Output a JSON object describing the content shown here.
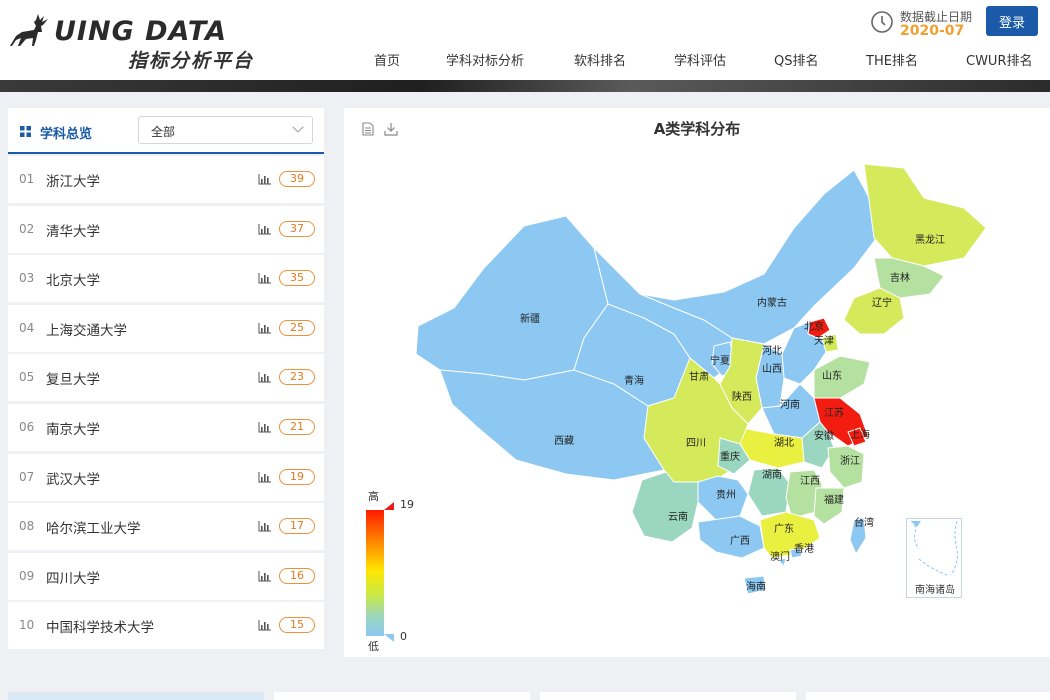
{
  "header": {
    "brand": "UING DATA",
    "subtitle": "指标分析平台",
    "date_label": "数据截止日期",
    "date_value": "2020-07",
    "login_label": "登录",
    "nav": [
      "首页",
      "学科对标分析",
      "软科排名",
      "学科评估",
      "QS排名",
      "THE排名",
      "CWUR排名"
    ]
  },
  "left_panel": {
    "title": "学科总览",
    "select_value": "全部",
    "items": [
      {
        "no": "01",
        "name": "浙江大学",
        "count": "39"
      },
      {
        "no": "02",
        "name": "清华大学",
        "count": "37"
      },
      {
        "no": "03",
        "name": "北京大学",
        "count": "35"
      },
      {
        "no": "04",
        "name": "上海交通大学",
        "count": "25"
      },
      {
        "no": "05",
        "name": "复旦大学",
        "count": "23"
      },
      {
        "no": "06",
        "name": "南京大学",
        "count": "21"
      },
      {
        "no": "07",
        "name": "武汉大学",
        "count": "19"
      },
      {
        "no": "08",
        "name": "哈尔滨工业大学",
        "count": "17"
      },
      {
        "no": "09",
        "name": "四川大学",
        "count": "16"
      },
      {
        "no": "10",
        "name": "中国科学技术大学",
        "count": "15"
      }
    ]
  },
  "map": {
    "title": "A类学科分布",
    "legend_high": "高",
    "legend_low": "低",
    "legend_max": "19",
    "legend_min": "0",
    "inset_label": "南海诸岛",
    "colors": {
      "blue": "#8cc8f2",
      "teal": "#9ad6c0",
      "green": "#b4e0a0",
      "lime": "#d4ea5a",
      "yellow": "#eaf040",
      "red": "#f21c10"
    },
    "regions": [
      {
        "name": "新疆",
        "level": "blue"
      },
      {
        "name": "西藏",
        "level": "blue"
      },
      {
        "name": "青海",
        "level": "blue"
      },
      {
        "name": "甘肃",
        "level": "blue"
      },
      {
        "name": "内蒙古",
        "level": "blue"
      },
      {
        "name": "黑龙江",
        "level": "lime"
      },
      {
        "name": "吉林",
        "level": "green"
      },
      {
        "name": "辽宁",
        "level": "lime"
      },
      {
        "name": "北京",
        "level": "red"
      },
      {
        "name": "天津",
        "level": "lime"
      },
      {
        "name": "河北",
        "level": "blue"
      },
      {
        "name": "山西",
        "level": "blue"
      },
      {
        "name": "宁夏",
        "level": "blue"
      },
      {
        "name": "陕西",
        "level": "lime"
      },
      {
        "name": "山东",
        "level": "green"
      },
      {
        "name": "河南",
        "level": "blue"
      },
      {
        "name": "江苏",
        "level": "red"
      },
      {
        "name": "上海",
        "level": "red"
      },
      {
        "name": "安徽",
        "level": "teal"
      },
      {
        "name": "湖北",
        "level": "yellow"
      },
      {
        "name": "四川",
        "level": "lime"
      },
      {
        "name": "重庆",
        "level": "teal"
      },
      {
        "name": "浙江",
        "level": "green"
      },
      {
        "name": "湖南",
        "level": "teal"
      },
      {
        "name": "江西",
        "level": "green"
      },
      {
        "name": "福建",
        "level": "green"
      },
      {
        "name": "贵州",
        "level": "blue"
      },
      {
        "name": "云南",
        "level": "teal"
      },
      {
        "name": "广西",
        "level": "blue"
      },
      {
        "name": "广东",
        "level": "yellow"
      },
      {
        "name": "香港",
        "level": "blue"
      },
      {
        "name": "澳门",
        "level": "blue"
      },
      {
        "name": "台湾",
        "level": "blue"
      },
      {
        "name": "海南",
        "level": "blue"
      }
    ]
  },
  "bottom_tabs": [
    "",
    "",
    "",
    ""
  ]
}
